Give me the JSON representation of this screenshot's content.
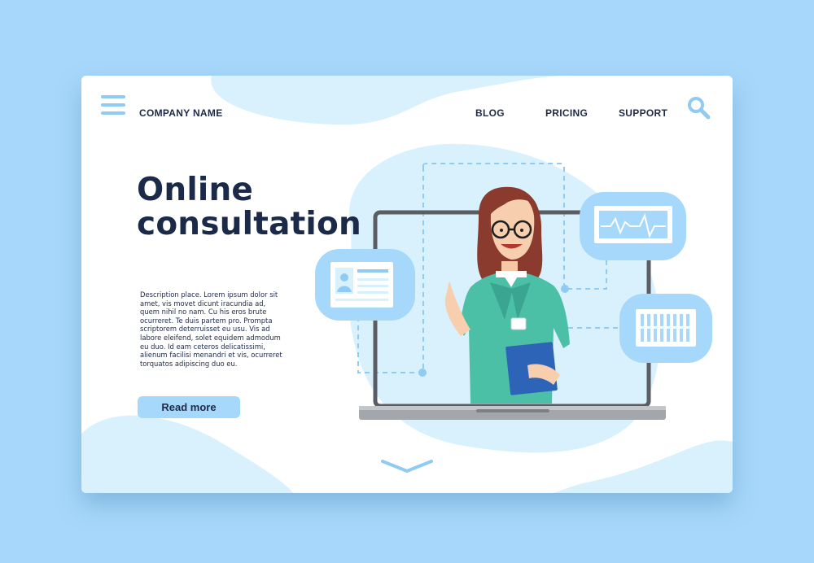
{
  "header": {
    "company_name": "COMPANY NAME",
    "nav": [
      "BLOG",
      "PRICING",
      "SUPPORT"
    ]
  },
  "hero": {
    "title_line1": "Online",
    "title_line2": "consultation",
    "description": "Description place.  Lorem ipsum dolor sit amet, vis movet dicunt iracundia ad, quem nihil no nam. Cu his eros brute ocurreret. Te duis partem pro. Prompta scriptorem deterruisset eu usu. Vis ad labore eleifend, solet equidem admodum eu duo. Id eam ceteros delicatissimi, alienum facilisi menandri et vis, ocurreret torquatos adipiscing duo eu.",
    "read_more": "Read more"
  },
  "colors": {
    "background": "#a7d8fb",
    "accent": "#a6d8fb",
    "text": "#1e2a46",
    "doctor_scrubs": "#4cc0a6"
  },
  "icons": [
    "menu-icon",
    "search-icon",
    "chevron-down-icon",
    "patient-id-card-icon",
    "heartbeat-monitor-icon",
    "data-bars-icon"
  ]
}
